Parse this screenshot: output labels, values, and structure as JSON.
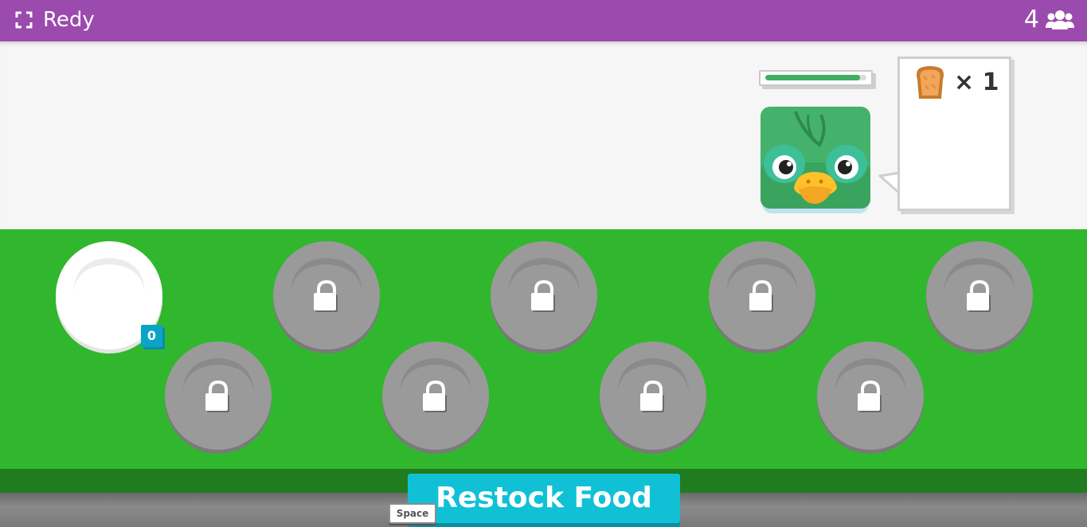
{
  "header": {
    "title": "Redy",
    "player_count": "4",
    "fullscreen_icon": "fullscreen-icon",
    "players_icon": "users-icon"
  },
  "customer": {
    "timer_fraction": 0.94,
    "order_item_icon": "toast-icon",
    "order_quantity": "× 1"
  },
  "plates": {
    "active_count": "0",
    "locked_count": 8
  },
  "actions": {
    "restock_label": "Restock Food",
    "restock_key": "Space"
  },
  "colors": {
    "header": "#9b4aad",
    "counter": "#31b72e",
    "button": "#10c1d6",
    "badge": "#0aa5c6"
  }
}
